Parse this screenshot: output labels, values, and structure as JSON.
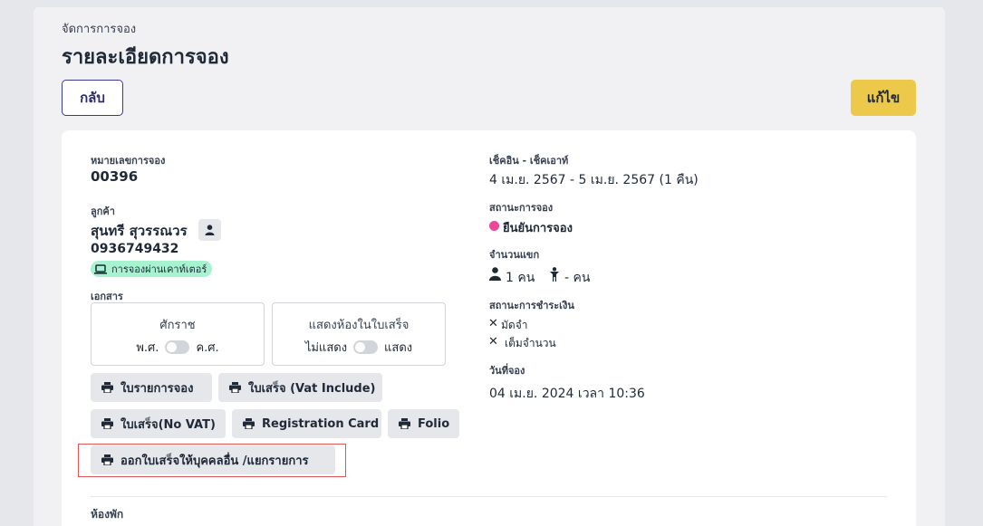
{
  "header": {
    "breadcrumb": "จัดการการจอง",
    "title": "รายละเอียดการจอง",
    "back_label": "กลับ",
    "edit_label": "แก้ไข"
  },
  "booking": {
    "number_label": "หมายเลขการจอง",
    "number_value": "00396",
    "customer_label": "ลูกค้า",
    "customer_name": "สุนทรี สุวรรณวร",
    "customer_phone": "0936749432",
    "channel_badge": "การจองผ่านเคาท์เตอร์",
    "documents_label": "เอกสาร"
  },
  "options": {
    "era": {
      "title": "ศักราช",
      "left": "พ.ศ.",
      "right": "ค.ศ."
    },
    "room_on_receipt": {
      "title": "แสดงห้องในใบเสร็จ",
      "left": "ไม่แสดง",
      "right": "แสดง"
    }
  },
  "print_buttons": [
    "ใบรายการจอง",
    "ใบเสร็จ (Vat Include)",
    "ใบเสร็จ(No VAT)",
    "Registration Card",
    "Folio",
    "ออกใบเสร็จให้บุคคลอื่น /แยกรายการ"
  ],
  "right": {
    "checkin_label": "เช็คอิน - เช็คเอาท์",
    "checkin_value": "4 เม.ย. 2567  -  5 เม.ย. 2567  (1 คืน)",
    "status_label": "สถานะการจอง",
    "status_value": "ยืนยันการจอง",
    "status_color": "#ec4899",
    "guests_label": "จำนวนแขก",
    "adults": "1 คน",
    "children": "- คน",
    "payment_label": "สถานะการชำระเงิน",
    "deposit": "มัดจำ",
    "full": "เต็มจำนวน",
    "booking_date_label": "วันที่จอง",
    "booking_date_value": "04 เม.ย. 2024 เวลา 10:36"
  },
  "rooms_label": "ห้องพัก"
}
